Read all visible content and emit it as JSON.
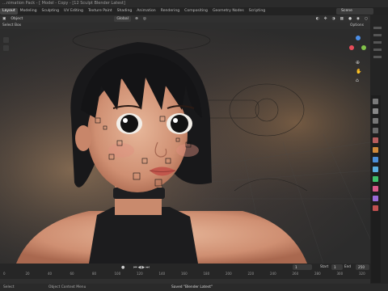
{
  "app": {
    "title": "…nimation Pack - [ Model - Copy - [12 Sculpt Blender Latest]"
  },
  "workspaces": [
    "Layout",
    "Modeling",
    "Sculpting",
    "UV Editing",
    "Texture Paint",
    "Shading",
    "Animation",
    "Rendering",
    "Compositing",
    "Geometry Nodes",
    "Scripting"
  ],
  "active_workspace": "Layout",
  "scene": {
    "label": "Scene"
  },
  "header": {
    "mode": "Object",
    "orientation": "Global",
    "select_box": "Select Box",
    "options": "Options"
  },
  "timeline": {
    "frame_ticks": [
      "0",
      "20",
      "40",
      "60",
      "80",
      "100",
      "120",
      "140",
      "160",
      "180",
      "200",
      "220",
      "240",
      "260",
      "280",
      "300",
      "320"
    ],
    "current_frame": "1",
    "start_label": "Start",
    "start_value": "1",
    "end_label": "End",
    "end_value": "250"
  },
  "status": {
    "left": "Select",
    "middle": "Object Context Menu",
    "message": "Saved \"Blender Latest\""
  },
  "icons": [
    "cursor-icon",
    "move-icon",
    "rotate-icon",
    "scale-icon",
    "camera-icon",
    "hand-icon",
    "play-icon"
  ]
}
